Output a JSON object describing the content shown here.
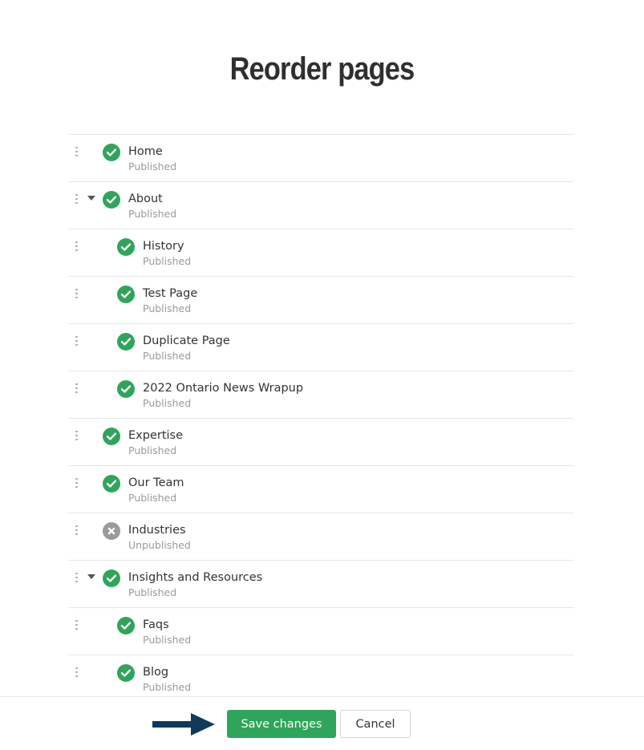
{
  "title": "Reorder pages",
  "pages": [
    {
      "name": "Home",
      "status": "Published",
      "level": 0,
      "state": "published",
      "expandable": false
    },
    {
      "name": "About",
      "status": "Published",
      "level": 0,
      "state": "published",
      "expandable": true
    },
    {
      "name": "History",
      "status": "Published",
      "level": 1,
      "state": "published",
      "expandable": false
    },
    {
      "name": "Test Page",
      "status": "Published",
      "level": 1,
      "state": "published",
      "expandable": false
    },
    {
      "name": "Duplicate Page",
      "status": "Published",
      "level": 1,
      "state": "published",
      "expandable": false
    },
    {
      "name": "2022 Ontario News Wrapup",
      "status": "Published",
      "level": 1,
      "state": "published",
      "expandable": false
    },
    {
      "name": "Expertise",
      "status": "Published",
      "level": 0,
      "state": "published",
      "expandable": false
    },
    {
      "name": "Our Team",
      "status": "Published",
      "level": 0,
      "state": "published",
      "expandable": false
    },
    {
      "name": "Industries",
      "status": "Unpublished",
      "level": 0,
      "state": "unpublished",
      "expandable": false
    },
    {
      "name": "Insights and Resources",
      "status": "Published",
      "level": 0,
      "state": "published",
      "expandable": true
    },
    {
      "name": "Faqs",
      "status": "Published",
      "level": 1,
      "state": "published",
      "expandable": false
    },
    {
      "name": "Blog",
      "status": "Published",
      "level": 1,
      "state": "published",
      "expandable": false
    }
  ],
  "footer": {
    "save_label": "Save changes",
    "cancel_label": "Cancel"
  },
  "colors": {
    "published": "#2fa55b",
    "unpublished": "#9a9a9a",
    "arrow": "#0e3a5c"
  },
  "icons": {
    "published": "check-circle-icon",
    "unpublished": "x-circle-icon",
    "handle": "drag-handle-icon",
    "caret": "caret-down-icon",
    "arrow": "arrow-right-icon"
  }
}
